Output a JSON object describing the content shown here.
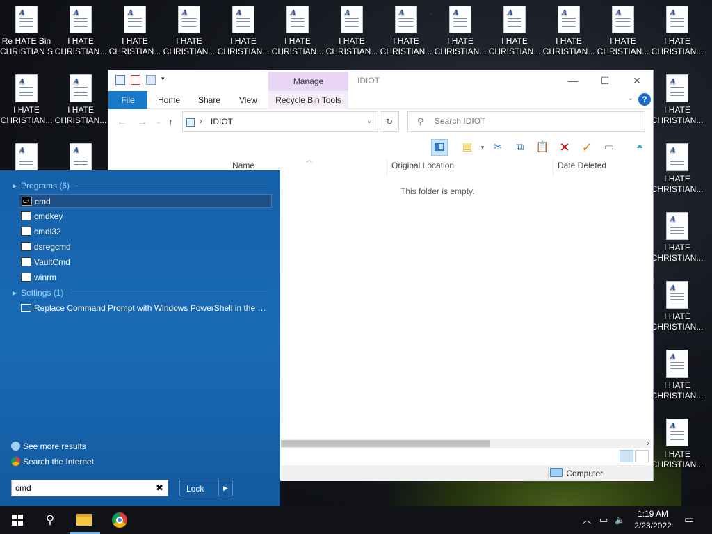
{
  "desktop": {
    "icons": [
      {
        "label": "Re HATE Bin\nCHRISTIAN S"
      },
      {
        "label": "I HATE\nCHRISTIAN..."
      },
      {
        "label": "I HATE\nCHRISTIAN..."
      },
      {
        "label": "I HATE\nCHRISTIAN..."
      },
      {
        "label": "I HATE\nCHRISTIAN..."
      },
      {
        "label": "I HATE\nCHRISTIAN..."
      },
      {
        "label": "I HATE\nCHRISTIAN..."
      },
      {
        "label": "I HATE\nCHRISTIAN..."
      },
      {
        "label": "I HATE\nCHRISTIAN..."
      },
      {
        "label": "I HATE\nCHRISTIAN..."
      },
      {
        "label": "I HATE\nCHRISTIAN..."
      },
      {
        "label": "I HATE\nCHRISTIAN..."
      },
      {
        "label": "I HATE\nCHRISTIAN..."
      },
      {
        "label": "I HATE\nCHRISTIAN..."
      },
      {
        "label": "I HATE\nCHRISTIAN..."
      },
      {
        "label": "I HATE\nCHRISTIAN..."
      },
      {
        "label": "I HATE\nCHRISTIAN..."
      },
      {
        "label": "I HATE\nCHRISTIAN..."
      },
      {
        "label": "I HATE\nCHRISTIAN..."
      },
      {
        "label": "I HATE\nCHRISTIAN..."
      },
      {
        "label": "I HATE\nCHRISTIAN..."
      },
      {
        "label": "I HATE\nCHRISTIAN..."
      }
    ]
  },
  "explorer": {
    "title": "IDIOT",
    "manage_tab": "Manage",
    "tabs": {
      "file": "File",
      "home": "Home",
      "share": "Share",
      "view": "View",
      "recycle_bin_tools": "Recycle Bin Tools"
    },
    "window_controls": {
      "minimize": "—",
      "maximize": "☐",
      "close": "✕"
    },
    "help": "?",
    "address": {
      "separator": "›",
      "path": "IDIOT"
    },
    "search_placeholder": "Search IDIOT",
    "columns": {
      "name": "Name",
      "original_location": "Original Location",
      "date_deleted": "Date Deleted"
    },
    "empty_message": "This folder is empty.",
    "status": {
      "computer": "Computer"
    },
    "toolbar_icons": [
      "preview-pane-icon",
      "properties-icon",
      "cut-icon",
      "copy-icon",
      "paste-icon",
      "delete-icon",
      "check-icon",
      "rename-icon",
      "globe-icon"
    ]
  },
  "start_menu": {
    "programs_header": "Programs (6)",
    "programs": [
      {
        "label": "cmd",
        "icon": "cmd-icon"
      },
      {
        "label": "cmdkey",
        "icon": "app-window-icon"
      },
      {
        "label": "cmdl32",
        "icon": "app-icon"
      },
      {
        "label": "dsregcmd",
        "icon": "app-window-icon"
      },
      {
        "label": "VaultCmd",
        "icon": "app-window-icon"
      },
      {
        "label": "winrm",
        "icon": "app-window-icon"
      }
    ],
    "settings_header": "Settings (1)",
    "settings": [
      {
        "label": "Replace Command Prompt with Windows PowerShell in the W...",
        "icon": "settings-icon"
      }
    ],
    "see_more": "See more results",
    "search_internet": "Search the Internet",
    "search_value": "cmd",
    "clear": "✖",
    "lock_label": "Lock",
    "lock_arrow": "▶"
  },
  "taskbar": {
    "search_icon": "⚲",
    "tray": {
      "chevron": "︿",
      "network": "▭",
      "volume": "🔈"
    },
    "time": "1:19 AM",
    "date": "2/23/2022",
    "notification": "▭"
  },
  "colors": {
    "start_menu_bg": "#1a6ab6",
    "accent": "#1979ca",
    "manage_tab": "#e9d6f4",
    "taskbar": "#101216"
  }
}
